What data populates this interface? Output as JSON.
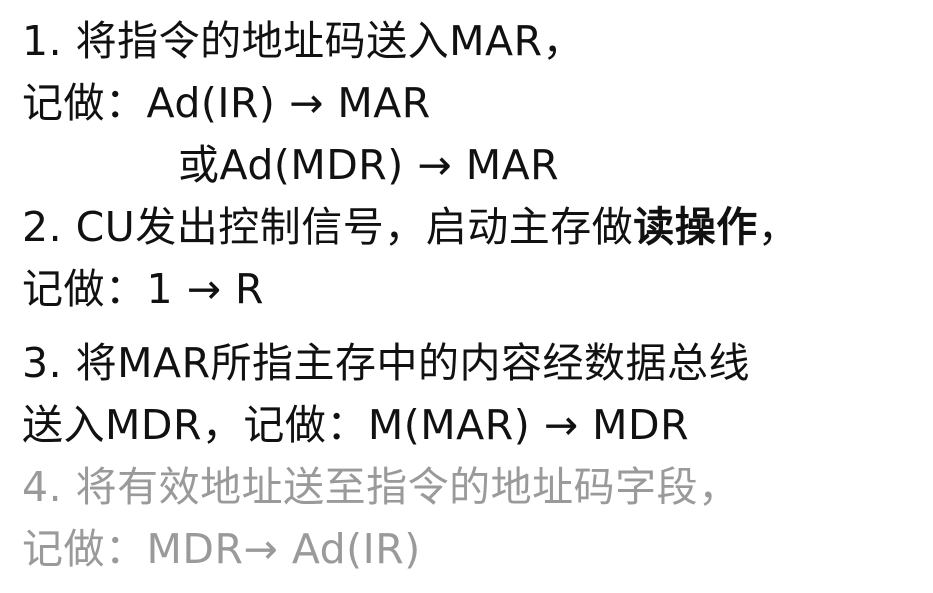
{
  "lines": {
    "l1": "1. 将指令的地址码送入MAR，",
    "l2": "记做：Ad(IR) → MAR",
    "l3": "或Ad(MDR) → MAR",
    "l4a": "2. CU发出控制信号，启动主存做",
    "l4b": "读操作",
    "l4c": "，",
    "l5": "记做：1 → R",
    "l6": "3. 将MAR所指主存中的内容经数据总线",
    "l7": "送入MDR，记做：M(MAR) → MDR",
    "l8": "4. 将有效地址送至指令的地址码字段，",
    "l9": "记做：MDR→ Ad(IR)"
  },
  "colors": {
    "text": "#111111",
    "muted": "#9a9a9a",
    "background": "#ffffff"
  }
}
